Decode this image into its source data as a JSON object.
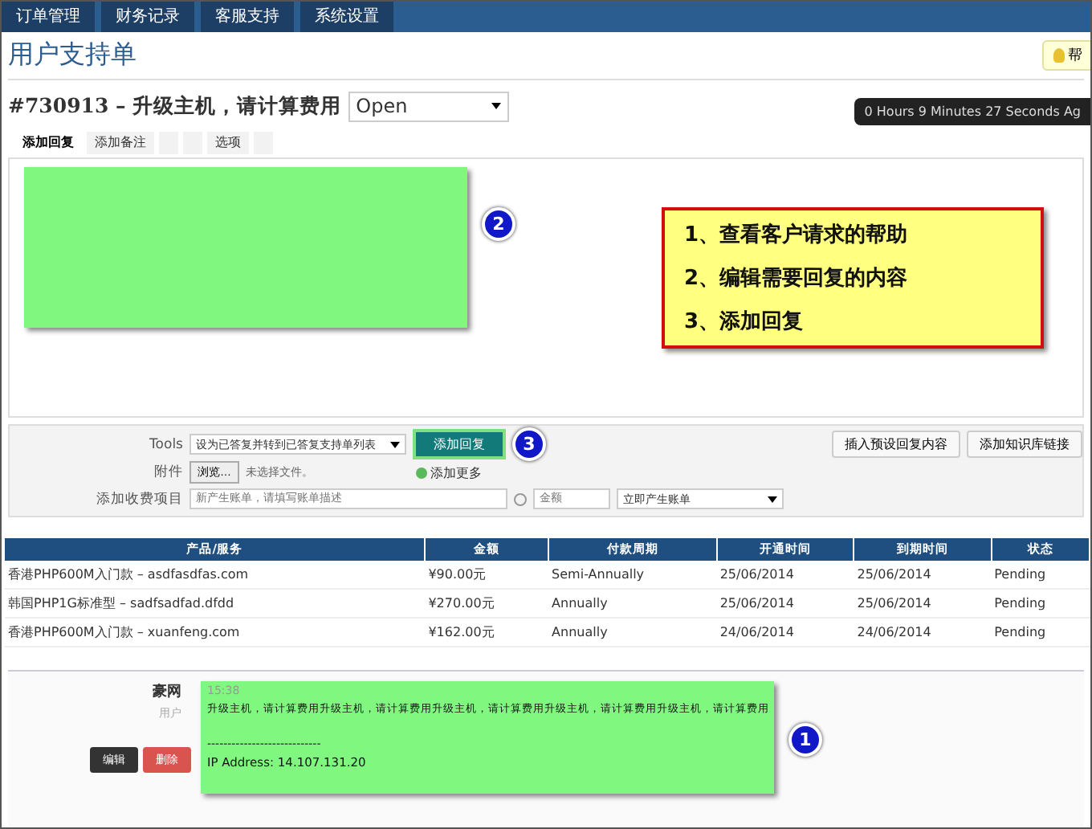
{
  "nav": {
    "items": [
      {
        "label": "订单管理",
        "selected": false
      },
      {
        "label": "财务记录",
        "selected": false
      },
      {
        "label": "客服支持",
        "selected": false
      },
      {
        "label": "系统设置",
        "selected": false
      }
    ]
  },
  "page_title": "用户支持单",
  "help_button": "帮",
  "ticket": {
    "title": "#730913 – 升级主机，请计算费用",
    "status": "Open",
    "timer": "0 Hours 9 Minutes 27 Seconds Ag"
  },
  "tabs": [
    {
      "label": "添加回复",
      "selected": true
    },
    {
      "label": "添加备注",
      "selected": false
    },
    {
      "selected": false
    },
    {
      "selected": false
    },
    {
      "label": "选项",
      "selected": false
    },
    {
      "selected": false
    }
  ],
  "callouts": [
    "2",
    "3",
    "1"
  ],
  "note": {
    "lines": [
      "1、查看客户请求的帮助",
      "2、编辑需要回复的内容",
      "3、添加回复"
    ]
  },
  "tools": {
    "label": "Tools",
    "select": "设为已答复并转到已答复支持单列表",
    "reply_button": "添加回复",
    "insert_button": "插入预设回复内容",
    "kb_button": "添加知识库链接"
  },
  "attachment": {
    "label": "附件",
    "browse": "浏览…",
    "no_file": "未选择文件。",
    "add_more": "添加更多"
  },
  "billing": {
    "label": "添加收费项目",
    "description_placeholder": "新产生账单，请填写账单描述",
    "amount_placeholder": "金额",
    "option": "立即产生账单"
  },
  "table": {
    "columns": [
      "产品/服务",
      "金额",
      "付款周期",
      "开通时间",
      "到期时间",
      "状态"
    ],
    "rows": [
      [
        "香港PHP600M入门款 – asdfasdfas.com",
        "¥90.00元",
        "Semi-Annually",
        "25/06/2014",
        "25/06/2014",
        "Pending"
      ],
      [
        "韩国PHP1G标准型 – sadfsadfad.dfdd",
        "¥270.00元",
        "Annually",
        "25/06/2014",
        "25/06/2014",
        "Pending"
      ],
      [
        "香港PHP600M入门款 – xuanfeng.com",
        "¥162.00元",
        "Annually",
        "24/06/2014",
        "24/06/2014",
        "Pending"
      ]
    ]
  },
  "reply": {
    "author": "豪网",
    "role": "用户",
    "edit": "编辑",
    "delete": "删除",
    "time": "15:38",
    "message": "升级主机，请计算费用升级主机，请计算费用升级主机，请计算费用升级主机，请计算费用升级主机，请计算费用",
    "separator": "----------------------------",
    "ip": "IP Address: 14.107.131.20"
  }
}
